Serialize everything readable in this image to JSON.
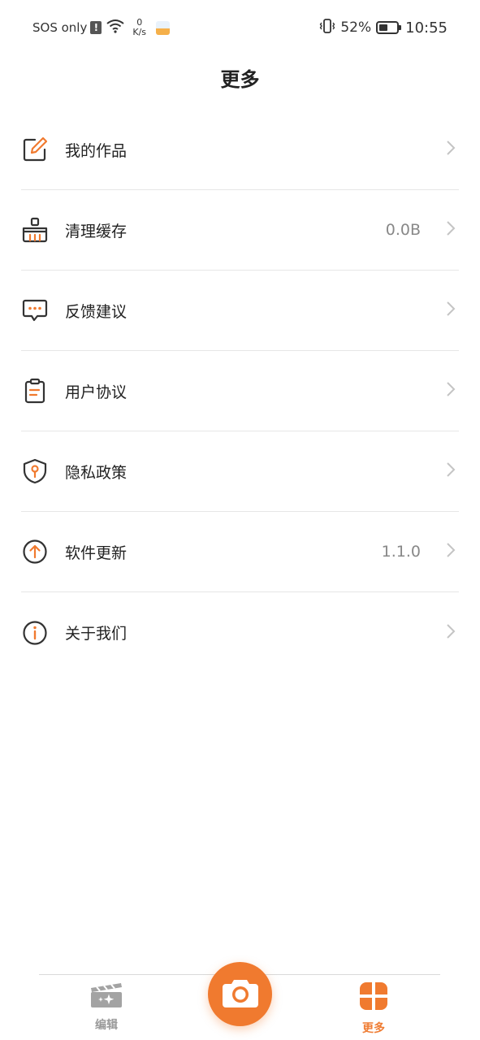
{
  "status_bar": {
    "carrier": "SOS only",
    "network_speed_value": "0",
    "network_speed_unit": "K/s",
    "battery_percent": "52%",
    "battery_level": 0.52,
    "time": "10:55"
  },
  "header": {
    "title": "更多"
  },
  "menu": {
    "items": [
      {
        "label": "我的作品",
        "value": "",
        "icon": "edit-pencil-icon"
      },
      {
        "label": "清理缓存",
        "value": "0.0B",
        "icon": "brush-clean-icon"
      },
      {
        "label": "反馈建议",
        "value": "",
        "icon": "chat-bubble-icon"
      },
      {
        "label": "用户协议",
        "value": "",
        "icon": "clipboard-icon"
      },
      {
        "label": "隐私政策",
        "value": "",
        "icon": "shield-key-icon"
      },
      {
        "label": "软件更新",
        "value": "1.1.0",
        "icon": "arrow-up-circle-icon"
      },
      {
        "label": "关于我们",
        "value": "",
        "icon": "info-circle-icon"
      }
    ]
  },
  "bottom_nav": {
    "edit_label": "编辑",
    "more_label": "更多",
    "camera_icon": "camera-icon"
  },
  "colors": {
    "accent": "#F07A2F",
    "icon_dark": "#333333",
    "inactive_nav": "#9A9A9A"
  }
}
